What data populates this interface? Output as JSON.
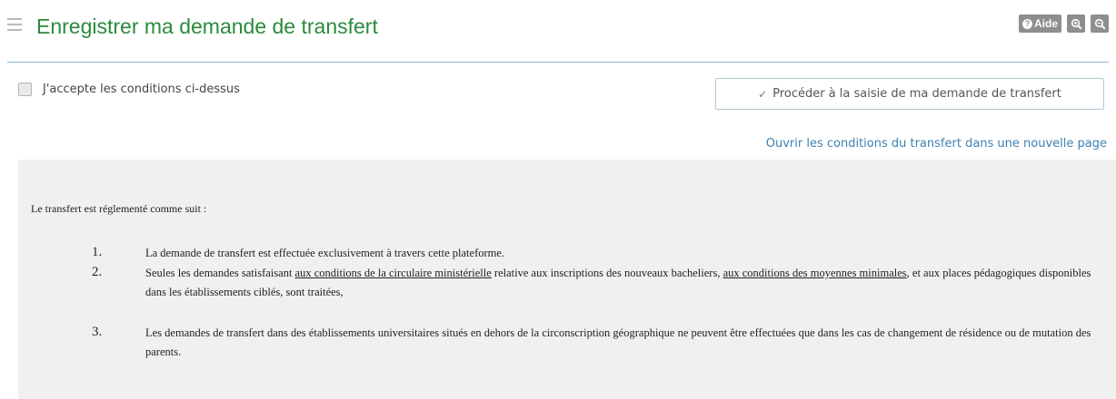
{
  "header": {
    "title": "Enregistrer ma demande de transfert",
    "help_label": "Aide"
  },
  "form": {
    "accept_label": "J'accepte les conditions ci-dessus",
    "proceed_label": "Procéder à la saisie de ma demande de transfert",
    "open_conditions_link": "Ouvrir les conditions du transfert dans une nouvelle page"
  },
  "conditions": {
    "intro": "Le transfert est réglementé comme suit :",
    "items": [
      {
        "number": "1.",
        "text": "La demande de transfert est effectuée exclusivement à travers cette plateforme."
      },
      {
        "number": "2.",
        "part1": "Seules les demandes satisfaisant ",
        "link1": "aux conditions de la circulaire ministérielle",
        "part2": " relative aux inscriptions des nouveaux bacheliers, ",
        "link2": "aux conditions des moyennes minimales",
        "part3": ", et aux places pédagogiques disponibles dans les établissements ciblés, sont traitées,"
      },
      {
        "number": "3.",
        "text": "Les demandes de transfert dans des établissements universitaires situés en dehors de la circonscription géographique ne peuvent être effectuées que dans les cas de changement de résidence ou de mutation des parents."
      }
    ]
  },
  "colors": {
    "title": "#2a8a3c",
    "link": "#3e80b0",
    "tool_button": "#8e8e8e",
    "panel_bg": "#f0f0f0",
    "rule": "#8ab5d3"
  },
  "icons": [
    "menu-icon",
    "help-icon",
    "zoom-in-icon",
    "zoom-out-icon",
    "check-icon"
  ]
}
